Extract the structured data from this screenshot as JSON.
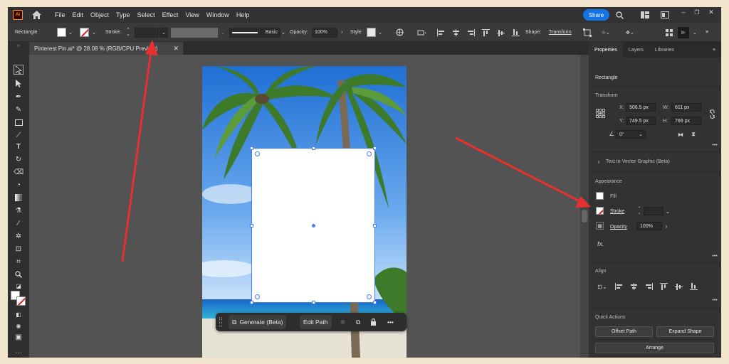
{
  "app": {
    "logo": "Ai"
  },
  "menu": [
    "File",
    "Edit",
    "Object",
    "Type",
    "Select",
    "Effect",
    "View",
    "Window",
    "Help"
  ],
  "share_label": "Share",
  "control": {
    "object_type": "Rectangle",
    "stroke_label": "Stroke:",
    "brush_label": "Basic",
    "opacity_label": "Opacity:",
    "opacity_value": "100%",
    "style_label": "Style:",
    "shape_label": "Shape:",
    "transform_label": "Transform"
  },
  "document_tab": {
    "title": "Pinterest Pin.ai* @ 28.08 % (RGB/CPU Preview)"
  },
  "panel": {
    "tabs": [
      "Properties",
      "Layers",
      "Libraries"
    ],
    "object_type": "Rectangle",
    "transform_title": "Transform",
    "x_label": "X:",
    "x_value": "506.5 px",
    "y_label": "Y:",
    "y_value": "749.5 px",
    "w_label": "W:",
    "w_value": "611 px",
    "h_label": "H:",
    "h_value": "769 px",
    "angle_value": "0°",
    "text_to_vector": "Text to Vector Graphic (Beta)",
    "appearance_title": "Appearance",
    "fill_label": "Fill",
    "stroke_label": "Stroke",
    "opacity_label": "Opacity",
    "opacity_value": "100%",
    "fx_label": "fx.",
    "align_title": "Align",
    "quick_actions_title": "Quick Actions",
    "offset_path": "Offset Path",
    "expand_shape": "Expand Shape",
    "arrange": "Arrange"
  },
  "contextual_bar": {
    "generate_label": "Generate (Beta)",
    "edit_path_label": "Edit Path"
  },
  "colors": {
    "accent": "#1473e6",
    "annotation_arrow": "#e8302f",
    "selection": "#4a7df0"
  }
}
